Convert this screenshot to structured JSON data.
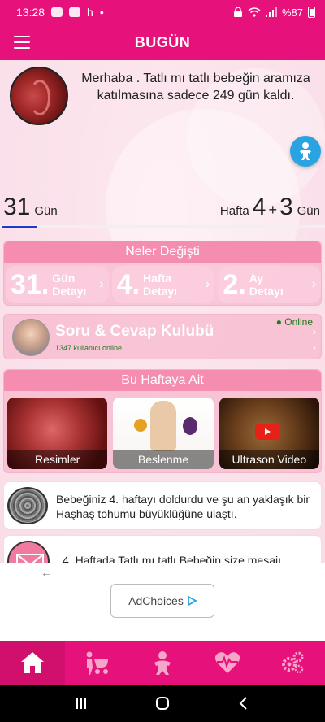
{
  "status_bar": {
    "time": "13:28",
    "notif_letter": "h",
    "dot": "•",
    "battery": "%87"
  },
  "app_bar": {
    "title": "BUGÜN"
  },
  "greeting": "Merhaba . Tatlı mı tatlı bebeğin aramıza katılmasına sadece 249 gün kaldı.",
  "day_counter": {
    "value": "31",
    "unit": "Gün"
  },
  "week_counter": {
    "label": "Hafta",
    "weeks": "4",
    "plus": "+",
    "days": "3",
    "unit": "Gün"
  },
  "progress": {
    "fraction": 0.11
  },
  "neler": {
    "header": "Neler Değişti",
    "items": [
      {
        "number": "31.",
        "line1": "Gün",
        "line2": "Detayı"
      },
      {
        "number": "4.",
        "line1": "Hafta",
        "line2": "Detayı"
      },
      {
        "number": "2.",
        "line1": "Ay",
        "line2": "Detayı"
      }
    ]
  },
  "soru_cevap": {
    "title": "Soru & Cevap Kulubü",
    "users_online": "1347 kullanıcı online",
    "online_label": "● Online"
  },
  "bu_hafta": {
    "header": "Bu Haftaya Ait",
    "tiles": [
      {
        "label": "Resimler"
      },
      {
        "label": "Beslenme"
      },
      {
        "label": "Ultrason Video"
      }
    ]
  },
  "info_cards": [
    {
      "text": "Bebeğiniz 4. haftayı doldurdu ve şu an yaklaşık bir Haşhaş tohumu büyüklüğüne ulaştı."
    },
    {
      "text": "4. Haftada Tatlı mı tatlı Bebeğin size mesajı"
    }
  ],
  "ad": {
    "back_arrow": "←",
    "choices_label": "AdChoices"
  },
  "bottom_nav": [
    "home-icon",
    "stroller-icon",
    "baby-icon",
    "heartbeat-icon",
    "settings-icon"
  ],
  "colors": {
    "primary": "#e6117a",
    "card_header": "#f58db0",
    "progress": "#1b3bc9",
    "fab": "#2aa3e3"
  }
}
